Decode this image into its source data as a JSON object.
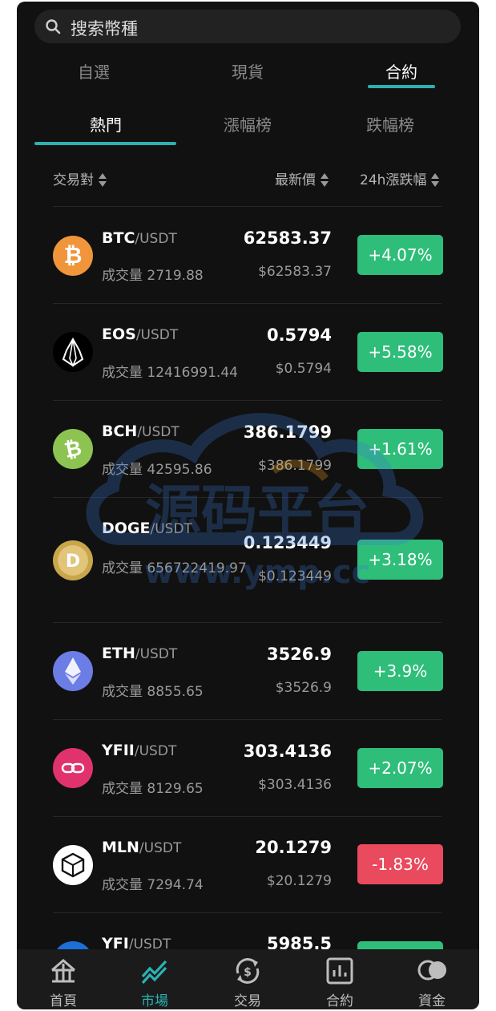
{
  "search": {
    "placeholder": "搜索幣種"
  },
  "top_tabs": [
    {
      "label": "自選",
      "active": false
    },
    {
      "label": "現貨",
      "active": false
    },
    {
      "label": "合約",
      "active": true
    }
  ],
  "sub_tabs": [
    {
      "label": "熱門",
      "active": true
    },
    {
      "label": "漲幅榜",
      "active": false
    },
    {
      "label": "跌幅榜",
      "active": false
    }
  ],
  "columns": {
    "pair": "交易對",
    "price": "最新價",
    "change": "24h漲跌幅"
  },
  "quote": "/USDT",
  "vol_label": "成交量",
  "rows": [
    {
      "base": "BTC",
      "vol": "2719.88",
      "price": "62583.37",
      "usd": "$62583.37",
      "change": "+4.07%",
      "dir": "up",
      "icon": "bitcoin-icon",
      "color": "#f0953a"
    },
    {
      "base": "EOS",
      "vol": "12416991.44",
      "price": "0.5794",
      "usd": "$0.5794",
      "change": "+5.58%",
      "dir": "up",
      "icon": "eos-icon",
      "color": "#000000"
    },
    {
      "base": "BCH",
      "vol": "42595.86",
      "price": "386.1799",
      "usd": "$386.1799",
      "change": "+1.61%",
      "dir": "up",
      "icon": "bitcoin-cash-icon",
      "color": "#8dc351"
    },
    {
      "base": "DOGE",
      "vol": "656722419.97",
      "price": "0.123449",
      "usd": "$0.123449",
      "change": "+3.18%",
      "dir": "up",
      "icon": "dogecoin-icon",
      "color": "#c8a64a"
    },
    {
      "base": "ETH",
      "vol": "8855.65",
      "price": "3526.9",
      "usd": "$3526.9",
      "change": "+3.9%",
      "dir": "up",
      "icon": "ethereum-icon",
      "color": "#6c7de6"
    },
    {
      "base": "YFII",
      "vol": "8129.65",
      "price": "303.4136",
      "usd": "$303.4136",
      "change": "+2.07%",
      "dir": "up",
      "icon": "yfii-icon",
      "color": "#e0336e"
    },
    {
      "base": "MLN",
      "vol": "7294.74",
      "price": "20.1279",
      "usd": "$20.1279",
      "change": "-1.83%",
      "dir": "down",
      "icon": "melon-icon",
      "color": "#ffffff"
    },
    {
      "base": "YFI",
      "vol": "",
      "price": "5985.5",
      "usd": "",
      "change": "",
      "dir": "up",
      "icon": "yfi-icon",
      "color": "#1b6fd6"
    }
  ],
  "nav": [
    {
      "label": "首頁",
      "icon": "home-icon",
      "active": false
    },
    {
      "label": "市場",
      "icon": "market-icon",
      "active": true
    },
    {
      "label": "交易",
      "icon": "trade-icon",
      "active": false
    },
    {
      "label": "合約",
      "icon": "contract-icon",
      "active": false
    },
    {
      "label": "資金",
      "icon": "assets-icon",
      "active": false
    }
  ],
  "watermark": {
    "title": "源码平台",
    "url": "www.ymp.cc"
  },
  "colors": {
    "accent": "#2bb3b3",
    "up": "#2fbd7a",
    "down": "#ea4a5e",
    "background": "#111111"
  }
}
